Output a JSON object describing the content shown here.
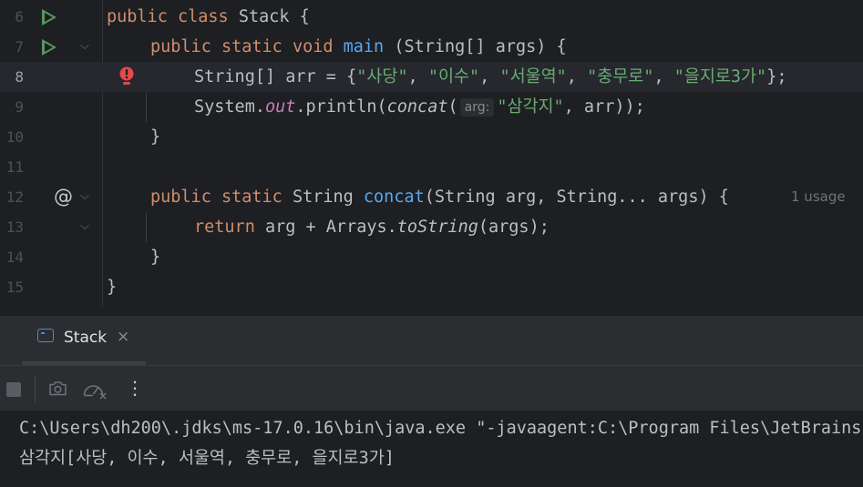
{
  "editor": {
    "lines": [
      {
        "num": "6"
      },
      {
        "num": "7"
      },
      {
        "num": "8"
      },
      {
        "num": "9"
      },
      {
        "num": "10"
      },
      {
        "num": "11"
      },
      {
        "num": "12"
      },
      {
        "num": "13"
      },
      {
        "num": "14"
      },
      {
        "num": "15"
      }
    ],
    "code": {
      "l6": {
        "kw1": "public",
        "kw2": "class",
        "name": "Stack {"
      },
      "l7": {
        "kw1": "public",
        "kw2": "static",
        "kw3": "void",
        "fn": "main",
        "rest": " (String[] args) {"
      },
      "l8": {
        "pre": "String[] arr = {",
        "s1": "\"사당\"",
        "c1": ", ",
        "s2": "\"이수\"",
        "c2": ", ",
        "s3": "\"서울역\"",
        "c3": ", ",
        "s4": "\"충무로\"",
        "c4": ", ",
        "s5": "\"을지로3가\"",
        "post": "};"
      },
      "l9": {
        "pre": "System.",
        "field": "out",
        "mid": ".println(",
        "call": "concat",
        "open": "(",
        "hint": "arg:",
        "str": "\"삼각지\"",
        "post": ", arr));"
      },
      "l10": {
        "text": "}"
      },
      "l12": {
        "kw1": "public",
        "kw2": "static",
        "type": "String",
        "fn": "concat",
        "rest": "(String arg, String... args) {"
      },
      "l12_usage": "1 usage",
      "l13": {
        "kw": "return",
        "pre": "arg + Arrays.",
        "call": "toString",
        "post": "(args);"
      },
      "l14": {
        "text": "}"
      },
      "l15": {
        "text": "}"
      }
    },
    "icons": {
      "run": "run-icon",
      "fold": "fold-icon",
      "error": "error-icon",
      "override": "at-icon"
    }
  },
  "tool_window": {
    "tab": {
      "label": "Stack",
      "close": "×"
    },
    "toolbar": {
      "stop": "stop-icon",
      "camera": "camera-icon",
      "profiler": "gauge-icon",
      "more": "⋮"
    },
    "console": {
      "line1": "C:\\Users\\dh200\\.jdks\\ms-17.0.16\\bin\\java.exe \"-javaagent:C:\\Program Files\\JetBrains",
      "line2": "삼각지[사당, 이수, 서울역, 충무로, 을지로3가]"
    }
  },
  "colors": {
    "keyword": "#cf8e6d",
    "function": "#56a8f5",
    "string": "#6aab73",
    "static_field": "#c77dbb",
    "run_icon": "#57965c",
    "error": "#e5484d"
  }
}
